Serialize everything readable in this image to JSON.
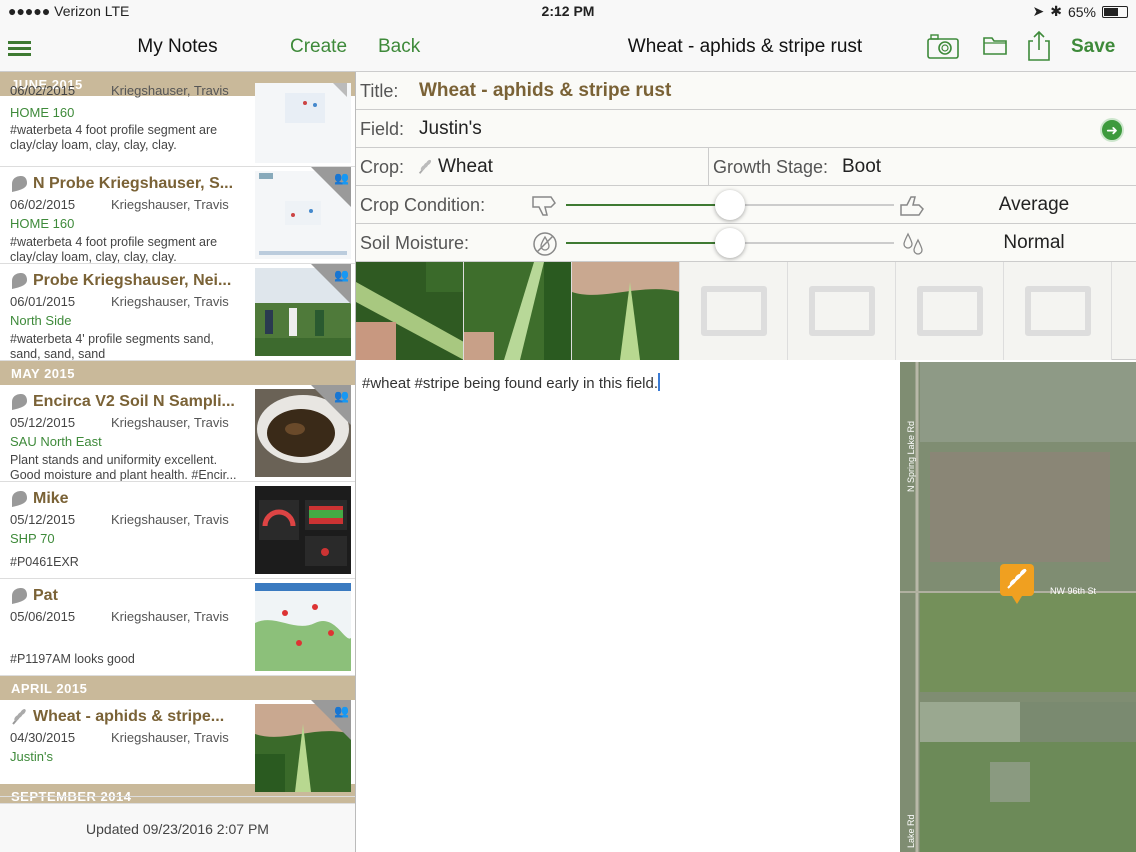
{
  "status_bar": {
    "carrier": "●●●●● Verizon  LTE",
    "time": "2:12 PM",
    "battery": "65%",
    "battery_level": 0.65
  },
  "nav": {
    "left_title": "My Notes",
    "create_label": "Create",
    "back_label": "Back",
    "center_title": "Wheat - aphids & stripe rust",
    "save_label": "Save"
  },
  "list": {
    "sections": [
      {
        "header": "JUNE 2015",
        "rows": [
          {
            "title": "",
            "date": "06/02/2015",
            "owner": "Kriegshauser, Travis",
            "field": "HOME 160",
            "text": "#waterbeta 4 foot profile segment are clay/clay loam, clay, clay, clay."
          },
          {
            "title": "N Probe Kriegshauser, S...",
            "date": "06/02/2015",
            "owner": "Kriegshauser, Travis",
            "field": "HOME 160",
            "text": "#waterbeta 4 foot profile segment are clay/clay loam, clay, clay, clay."
          },
          {
            "title": "Probe Kriegshauser, Nei...",
            "date": "06/01/2015",
            "owner": "Kriegshauser, Travis",
            "field": "North Side",
            "text": "#waterbeta 4' profile segments sand, sand, sand, sand"
          }
        ]
      },
      {
        "header": "MAY 2015",
        "rows": [
          {
            "title": "Encirca V2 Soil N Sampli...",
            "date": "05/12/2015",
            "owner": "Kriegshauser, Travis",
            "field": "SAU North East",
            "text": "Plant stands and uniformity excellent. Good moisture and plant health. #Encir..."
          },
          {
            "title": "Mike",
            "date": "05/12/2015",
            "owner": "Kriegshauser, Travis",
            "field": "SHP 70",
            "text": "#P0461EXR"
          },
          {
            "title": "Pat",
            "date": "05/06/2015",
            "owner": "Kriegshauser, Travis",
            "field": "",
            "text": "#P1197AM looks good"
          }
        ]
      },
      {
        "header": "APRIL 2015",
        "rows": [
          {
            "title": "Wheat - aphids & stripe...",
            "date": "04/30/2015",
            "owner": "Kriegshauser, Travis",
            "field": "Justin's",
            "text": ""
          }
        ]
      },
      {
        "header": "SEPTEMBER 2014",
        "rows": []
      }
    ],
    "updated": "Updated 09/23/2016 2:07 PM"
  },
  "form": {
    "title_label": "Title:",
    "title_value": "Wheat - aphids & stripe rust",
    "field_label": "Field:",
    "field_value": "Justin's",
    "crop_label": "Crop:",
    "crop_value": "Wheat",
    "growth_label": "Growth Stage:",
    "growth_value": "Boot",
    "condition_label": "Crop Condition:",
    "condition_value": "Average",
    "condition_level": 0.5,
    "moisture_label": "Soil Moisture:",
    "moisture_value": "Normal",
    "moisture_level": 0.5,
    "notes": "#wheat #stripe being found early in this field."
  },
  "map": {
    "road_1": "N Spring Lake Rd",
    "road_2": "NW 96th St",
    "road_3": "Lake Rd"
  },
  "colors": {
    "accent_green": "#3e8a3a",
    "brown": "#7a6236",
    "section_tan": "#c9b99a",
    "pin_orange": "#f0a020"
  }
}
